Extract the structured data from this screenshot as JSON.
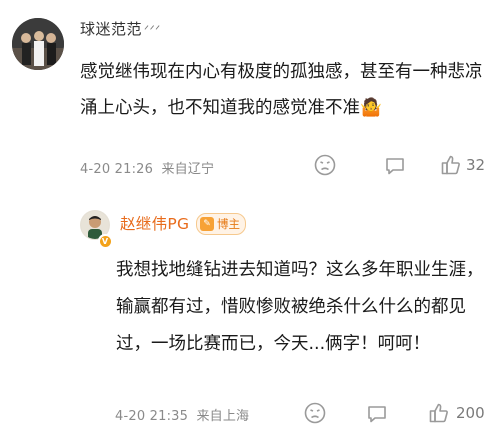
{
  "comment": {
    "username": "球迷范范",
    "username_suffix": "ᐟᐟᐟ",
    "text": "感觉继伟现在内心有极度的孤独感，甚至有一种悲凉涌上心头，也不知道我的感觉准不准🤷",
    "time": "4-20 21:26",
    "location": "来自辽宁",
    "likes": "32"
  },
  "reply": {
    "username": "赵继伟PG",
    "tag": "博主",
    "text": "我想找地缝钻进去知道吗？这么多年职业生涯，输赢都有过，惜败惨败被绝杀什么什么的都见过，一场比赛而已，今天...俩字！呵呵！",
    "time": "4-20 21:35",
    "location": "来自上海",
    "likes": "200"
  },
  "colors": {
    "author_name": "#e86b1b",
    "meta": "#8a8a8a",
    "icon": "#9a9a9a"
  }
}
